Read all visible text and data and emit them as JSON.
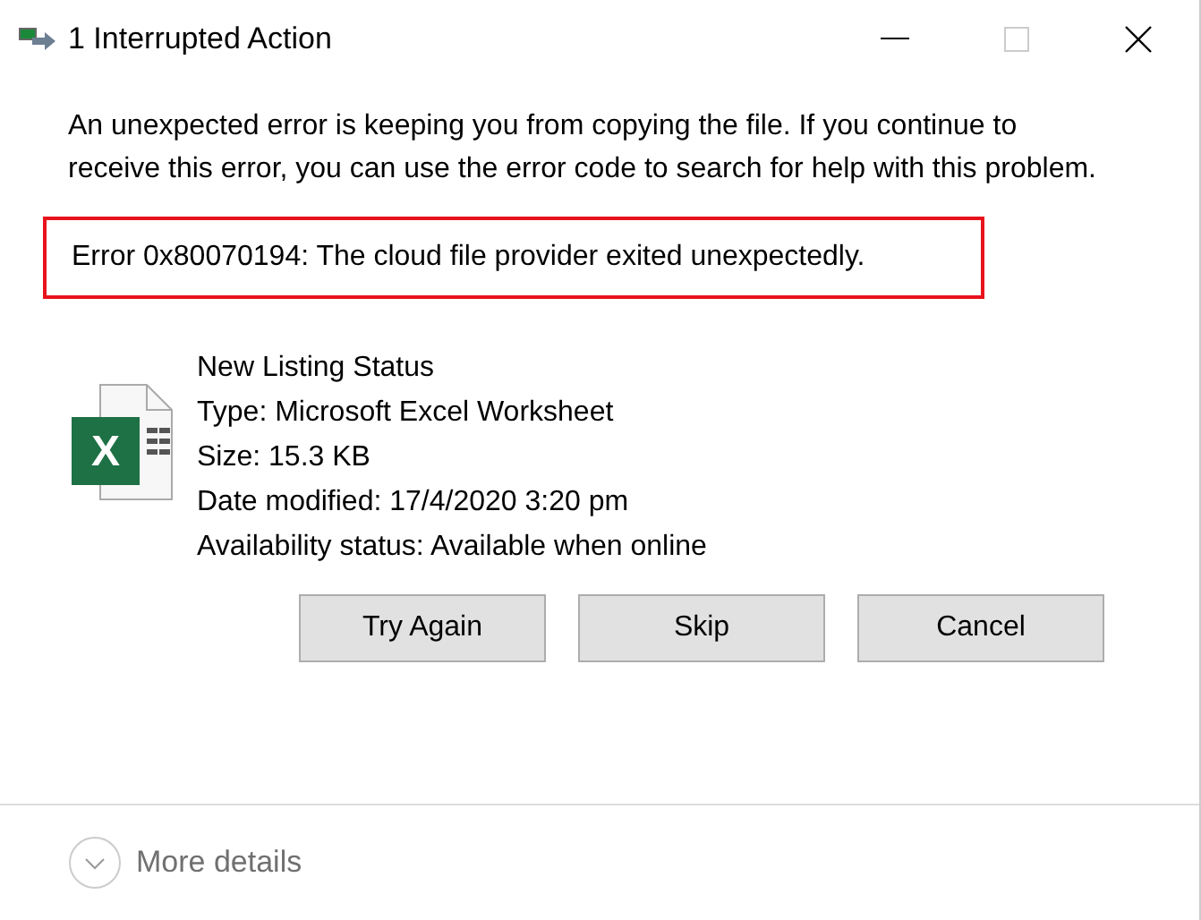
{
  "window": {
    "title": "1 Interrupted Action"
  },
  "message": "An unexpected error is keeping you from copying the file. If you continue to receive this error, you can use the error code to search for help with this problem.",
  "error": {
    "text": "Error 0x80070194: The cloud file provider exited unexpectedly.",
    "highlighted": true
  },
  "file": {
    "icon_letter": "X",
    "lines": [
      "New Listing Status",
      "Type: Microsoft Excel Worksheet",
      "Size: 15.3 KB",
      "Date modified: 17/4/2020 3:20 pm",
      "Availability status: Available when online"
    ]
  },
  "buttons": [
    "Try Again",
    "Skip",
    "Cancel"
  ],
  "footer": {
    "label": "More details",
    "expanded": false
  }
}
